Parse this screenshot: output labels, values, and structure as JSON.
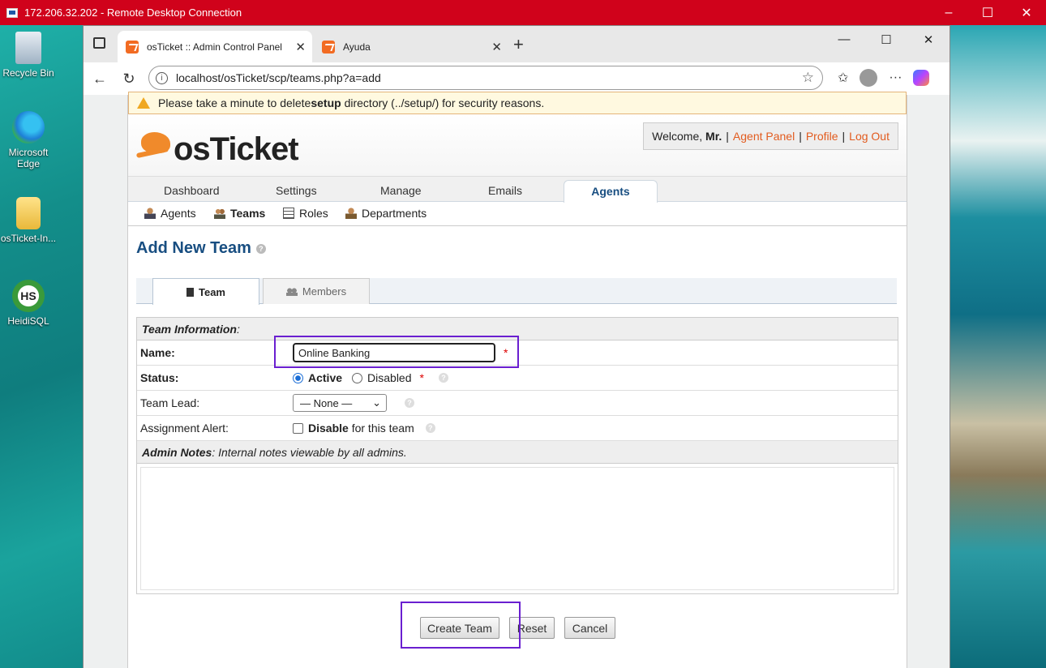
{
  "rdp": {
    "title": "172.206.32.202 - Remote Desktop Connection"
  },
  "desktop_icons": [
    {
      "label": "Recycle Bin"
    },
    {
      "label": "Microsoft Edge"
    },
    {
      "label": "osTicket-In..."
    },
    {
      "label": "HeidiSQL"
    }
  ],
  "browser": {
    "tabs": [
      {
        "title": "osTicket :: Admin Control Panel"
      },
      {
        "title": "Ayuda"
      }
    ],
    "url": "localhost/osTicket/scp/teams.php?a=add"
  },
  "page": {
    "warning": {
      "prefix": "Please take a minute to delete ",
      "bold": "setup",
      "suffix": " directory (../setup/) for security reasons."
    },
    "logo": "osTicket",
    "welcome": {
      "text": "Welcome, ",
      "user": "Mr.",
      "agent_panel": "Agent Panel",
      "profile": "Profile",
      "logout": "Log Out"
    },
    "nav": [
      "Dashboard",
      "Settings",
      "Manage",
      "Emails",
      "Agents"
    ],
    "subnav": [
      "Agents",
      "Teams",
      "Roles",
      "Departments"
    ],
    "title": "Add New Team",
    "form_tabs": [
      "Team",
      "Members"
    ],
    "section_header": "Team Information",
    "fields": {
      "name_label": "Name:",
      "name_value": "Online Banking",
      "status_label": "Status:",
      "status_active": "Active",
      "status_disabled": "Disabled",
      "lead_label": "Team Lead:",
      "lead_value": "— None —",
      "alert_label": "Assignment Alert:",
      "alert_bold": "Disable",
      "alert_rest": " for this team"
    },
    "notes": {
      "bold": "Admin Notes",
      "rest": ": Internal notes viewable by all admins."
    },
    "buttons": {
      "create": "Create Team",
      "reset": "Reset",
      "cancel": "Cancel"
    }
  },
  "colors": {
    "rdp_bar": "#d0021b",
    "brand_blue": "#184E81",
    "link_orange": "#e25b1e",
    "highlight": "#6a1fd0"
  }
}
